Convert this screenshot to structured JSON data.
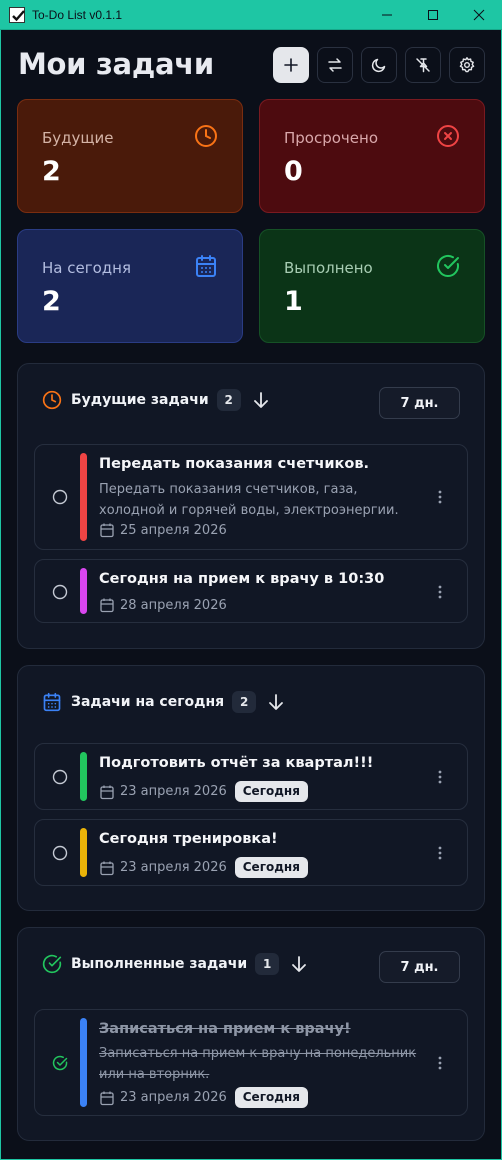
{
  "window": {
    "title": "To-Do List v0.1.1"
  },
  "page": {
    "title": "Мои задачи"
  },
  "stats": {
    "future": {
      "label": "Будущие",
      "value": "2",
      "color": "#f97316"
    },
    "overdue": {
      "label": "Просрочено",
      "value": "0",
      "color": "#ef4444"
    },
    "today": {
      "label": "На сегодня",
      "value": "2",
      "color": "#3b82f6"
    },
    "done": {
      "label": "Выполнено",
      "value": "1",
      "color": "#22c55e"
    }
  },
  "sections": {
    "future": {
      "title": "Будущие задачи",
      "count": "2",
      "days": "7 дн.",
      "tasks": [
        {
          "title": "Передать показания счетчиков.",
          "desc": "Передать показания счетчиков, газа, холодной и горячей воды, электроэнергии.",
          "date": "25 апреля 2026",
          "color": "#ef4444"
        },
        {
          "title": "Сегодня на прием к врачу в 10:30",
          "date": "28 апреля 2026",
          "color": "#d946ef"
        }
      ]
    },
    "today": {
      "title": "Задачи на сегодня",
      "count": "2",
      "tasks": [
        {
          "title": "Подготовить отчёт за квартал!!!",
          "date": "23 апреля 2026",
          "badge": "Сегодня",
          "color": "#22c55e"
        },
        {
          "title": "Сегодня тренировка!",
          "date": "23 апреля 2026",
          "badge": "Сегодня",
          "color": "#eab308"
        }
      ]
    },
    "done": {
      "title": "Выполненные задачи",
      "count": "1",
      "days": "7 дн.",
      "tasks": [
        {
          "title": "Записаться на прием к врачу!",
          "desc": "Записаться на прием к врачу на понедельник или на вторник.",
          "date": "23 апреля 2026",
          "badge": "Сегодня",
          "color": "#3b82f6"
        }
      ]
    }
  },
  "icons": {
    "toolbar": [
      "plus-icon",
      "swap-icon",
      "moon-icon",
      "pin-off-icon",
      "gear-icon"
    ]
  }
}
